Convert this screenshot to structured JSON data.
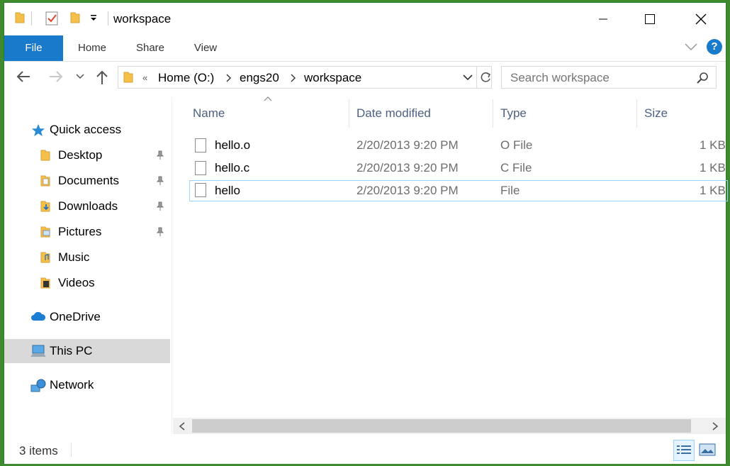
{
  "window": {
    "title": "workspace"
  },
  "quick_access_toolbar": {
    "folder_icon": "folder-icon",
    "properties_icon": "properties-check-icon",
    "new_folder_icon": "new-folder-icon",
    "customize_icon": "dropdown-arrow-icon"
  },
  "ribbon": {
    "tabs": [
      {
        "label": "File"
      },
      {
        "label": "Home"
      },
      {
        "label": "Share"
      },
      {
        "label": "View"
      }
    ],
    "help_label": "?"
  },
  "address_bar": {
    "overflow": "«",
    "crumbs": [
      "Home (O:)",
      "engs20",
      "workspace"
    ]
  },
  "search": {
    "placeholder": "Search workspace"
  },
  "sidebar": {
    "items": [
      {
        "label": "Quick access",
        "icon": "star-icon"
      },
      {
        "label": "Desktop",
        "icon": "folder-icon",
        "pinned": true
      },
      {
        "label": "Documents",
        "icon": "documents-folder-icon",
        "pinned": true
      },
      {
        "label": "Downloads",
        "icon": "downloads-folder-icon",
        "pinned": true
      },
      {
        "label": "Pictures",
        "icon": "pictures-folder-icon",
        "pinned": true
      },
      {
        "label": "Music",
        "icon": "music-folder-icon"
      },
      {
        "label": "Videos",
        "icon": "videos-folder-icon"
      },
      {
        "label": "OneDrive",
        "icon": "cloud-icon"
      },
      {
        "label": "This PC",
        "icon": "computer-icon",
        "selected": true
      },
      {
        "label": "Network",
        "icon": "network-icon"
      }
    ]
  },
  "columns": {
    "name": "Name",
    "date": "Date modified",
    "type": "Type",
    "size": "Size"
  },
  "files": [
    {
      "name": "hello.o",
      "date": "2/20/2013 9:20 PM",
      "type": "O File",
      "size": "1 KB"
    },
    {
      "name": "hello.c",
      "date": "2/20/2013 9:20 PM",
      "type": "C File",
      "size": "1 KB"
    },
    {
      "name": "hello",
      "date": "2/20/2013 9:20 PM",
      "type": "File",
      "size": "1 KB"
    }
  ],
  "status": {
    "item_count": "3 items"
  },
  "colors": {
    "accent": "#1979ca",
    "selection": "#d9d9d9",
    "header_text": "#4d6082"
  }
}
